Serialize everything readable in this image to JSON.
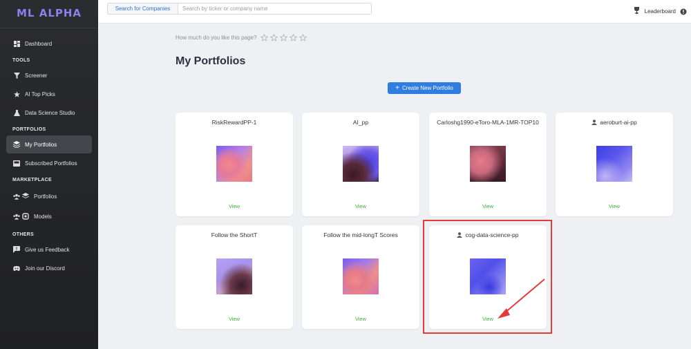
{
  "app": {
    "logo": "ML ALPHA"
  },
  "sidebar": {
    "items": [
      {
        "label": "Dashboard"
      },
      {
        "section": "TOOLS"
      },
      {
        "label": "Screener"
      },
      {
        "label": "AI Top Picks"
      },
      {
        "label": "Data Science Studio"
      },
      {
        "section": "PORTFOLIOS"
      },
      {
        "label": "My Portfolios"
      },
      {
        "label": "Subscribed Portfolios"
      },
      {
        "section": "MARKETPLACE"
      },
      {
        "label": "Portfolios"
      },
      {
        "label": "Models"
      },
      {
        "section": "OTHERS"
      },
      {
        "label": "Give us Feedback"
      },
      {
        "label": "Join our Discord"
      }
    ]
  },
  "topbar": {
    "search_tab": "Search for Companies",
    "search_placeholder": "Search by ticker or company name",
    "leaderboard": "Leaderboard"
  },
  "main": {
    "rating_prompt": "How much do you like this page?",
    "title": "My Portfolios",
    "create_button": "Create New Portfolio",
    "view_label": "View",
    "portfolios": [
      {
        "name": "RiskRewardPP-1",
        "shared": false
      },
      {
        "name": "AI_pp",
        "shared": false
      },
      {
        "name": "Carloshg1990-eToro-MLA-1MR-TOP10",
        "shared": false
      },
      {
        "name": "aeroburt-ai-pp",
        "shared": true
      },
      {
        "name": "Follow the ShortT",
        "shared": false
      },
      {
        "name": "Follow the mid-longT Scores",
        "shared": false
      },
      {
        "name": "cog-data-science-pp",
        "shared": true
      }
    ]
  },
  "colors": {
    "accent": "#2f7de1",
    "view_green": "#3cb03c",
    "highlight_red": "#e33a3a",
    "logo": "#8b80f0"
  }
}
